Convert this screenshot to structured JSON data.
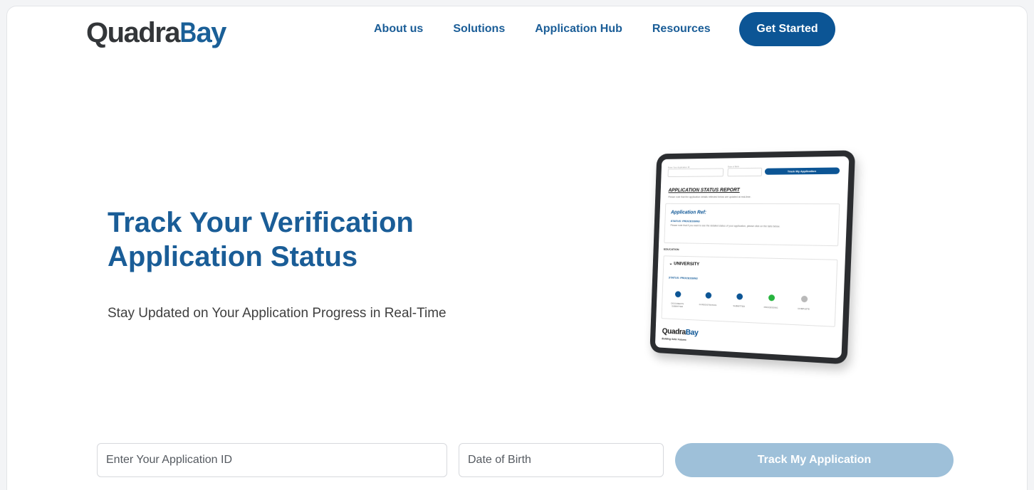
{
  "header": {
    "logo": {
      "prefix": "Quadra",
      "mark": "B",
      "suffix": "ay"
    },
    "nav": [
      {
        "label": "About us"
      },
      {
        "label": "Solutions"
      },
      {
        "label": "Application Hub"
      },
      {
        "label": "Resources"
      }
    ],
    "cta_label": "Get Started"
  },
  "hero": {
    "title": "Track Your Verification Application Status",
    "subtitle": "Stay Updated on Your Application Progress in Real-Time"
  },
  "tablet_screen": {
    "field1_label": "Enter Your Application ID",
    "field2_label": "Date of Birth",
    "button_label": "Track My Application",
    "report_title": "APPLICATION STATUS REPORT",
    "report_note": "Please note that the application details reflected below are updated at real-time.",
    "ref_label": "Application Ref:",
    "status_label": "STATUS: PROCESSING",
    "status_note": "Please note that if you want to see the detailed status of your application, please click on the tabs below.",
    "tab_label": "EDUCATION",
    "section_label": "UNIVERSITY",
    "section_status": "STATUS: PROCESSING",
    "steps": [
      {
        "label": "DOCUMENTS SUBMITTED",
        "state": "blue"
      },
      {
        "label": "IN REGISTRATION",
        "state": "blue"
      },
      {
        "label": "SUBMITTED",
        "state": "blue"
      },
      {
        "label": "PROCESSING",
        "state": "green"
      },
      {
        "label": "COMPLETE",
        "state": "grey"
      }
    ],
    "logo_prefix": "Quadra",
    "logo_mark": "B",
    "logo_suffix": "ay",
    "tagline": "Building Safer Futures"
  },
  "form": {
    "application_id_placeholder": "Enter Your Application ID",
    "dob_placeholder": "Date of Birth",
    "submit_label": "Track My Application"
  },
  "colors": {
    "brand_blue": "#0c5595",
    "nav_blue": "#1a5d97",
    "disabled_button": "#9ec0d9",
    "status_green": "#27b43e"
  }
}
